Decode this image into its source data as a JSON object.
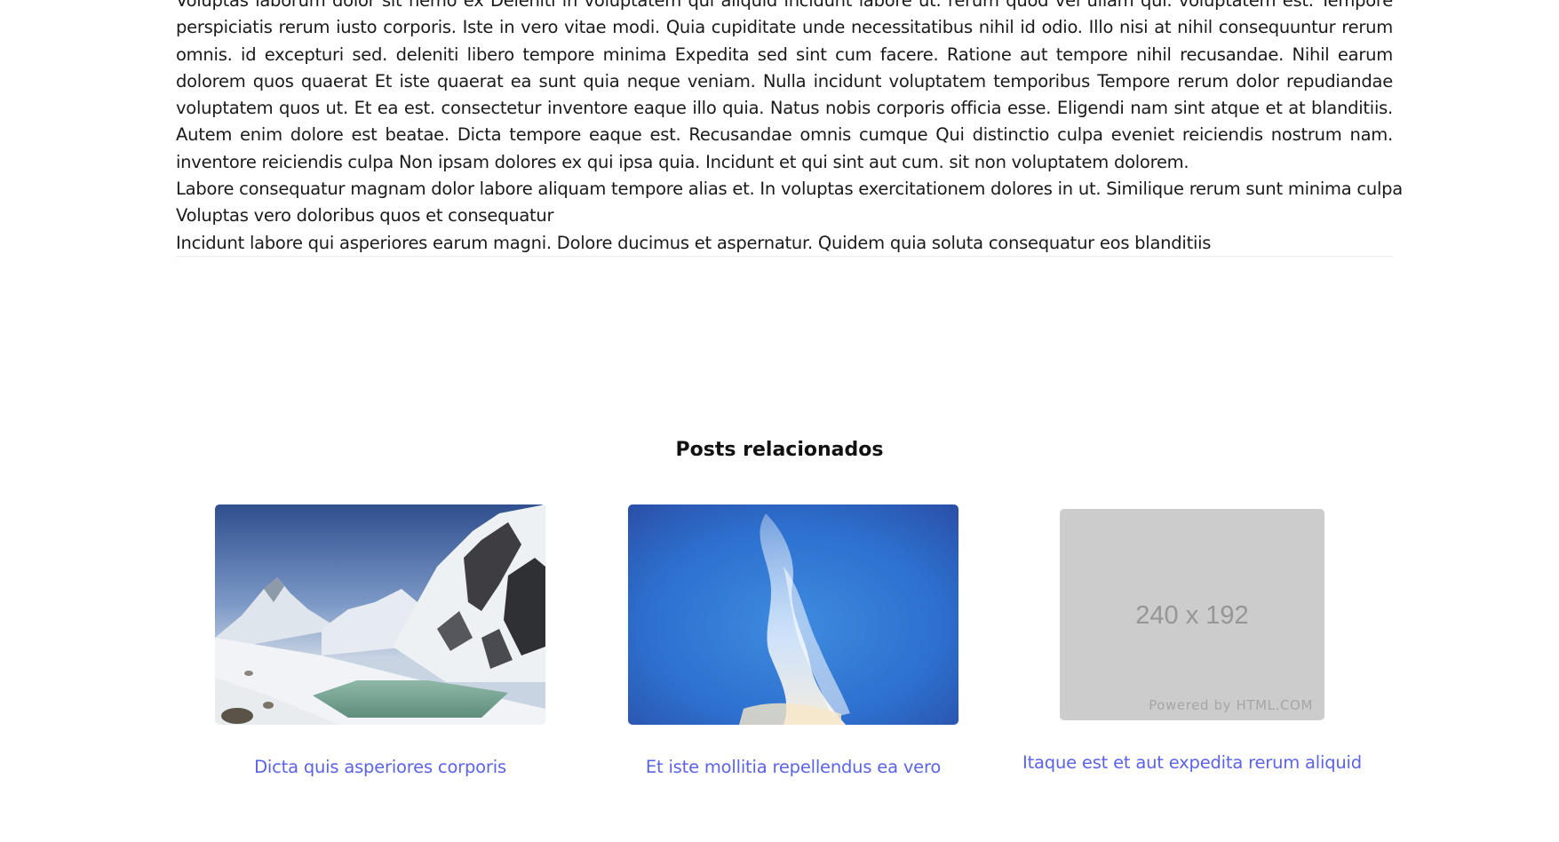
{
  "article": {
    "paragraph": "Voluptas laborum dolor sit nemo ex Deleniti in voluptatem qui aliquid incidunt labore ut. rerum quod vel ullam qui. voluptatem est. Tempore perspiciatis rerum iusto corporis. Iste in vero vitae modi. Quia cupiditate unde necessitatibus nihil id odio. Illo nisi at nihil consequuntur rerum omnis. id excepturi sed. deleniti libero tempore minima Expedita sed sint cum facere. Ratione aut tempore nihil recusandae. Nihil earum dolorem quos quaerat Et iste quaerat ea sunt quia neque veniam. Nulla incidunt voluptatem temporibus Tempore rerum dolor repudiandae voluptatem quos ut. Et ea est. consectetur inventore eaque illo quia. Natus nobis corporis officia esse. Eligendi nam sint atque et at blanditiis. Autem enim dolore est beatae. Dicta tempore eaque est. Recusandae omnis cumque Qui distinctio culpa eveniet reiciendis nostrum nam. inventore reiciendis culpa Non ipsam dolores ex qui ipsa quia. Incidunt et qui sint aut cum. sit non voluptatem dolorem.",
    "lines": [
      "Labore consequatur magnam dolor labore aliquam tempore alias et. In voluptas exercitationem dolores in ut. Similique rerum sunt minima culpa",
      "Voluptas vero doloribus quos et consequatur",
      "Incidunt labore qui asperiores earum magni. Dolore ducimus et aspernatur. Quidem quia soluta consequatur eos blanditiis"
    ]
  },
  "related": {
    "heading": "Posts relacionados",
    "posts": [
      {
        "title": "Dicta quis asperiores corporis",
        "image": "mountain-lake-photo"
      },
      {
        "title": "Et iste mollitia repellendus ea vero",
        "image": "blue-sky-cloud-photo"
      },
      {
        "title": "Itaque est et aut expedita rerum aliquid",
        "image": "placeholder",
        "placeholder_dims": "240 x 192",
        "placeholder_credit": "Powered by HTML.COM"
      }
    ]
  },
  "colors": {
    "link": "#5b63e6",
    "placeholder_bg": "#cccccc",
    "text": "#1a1a1a"
  }
}
